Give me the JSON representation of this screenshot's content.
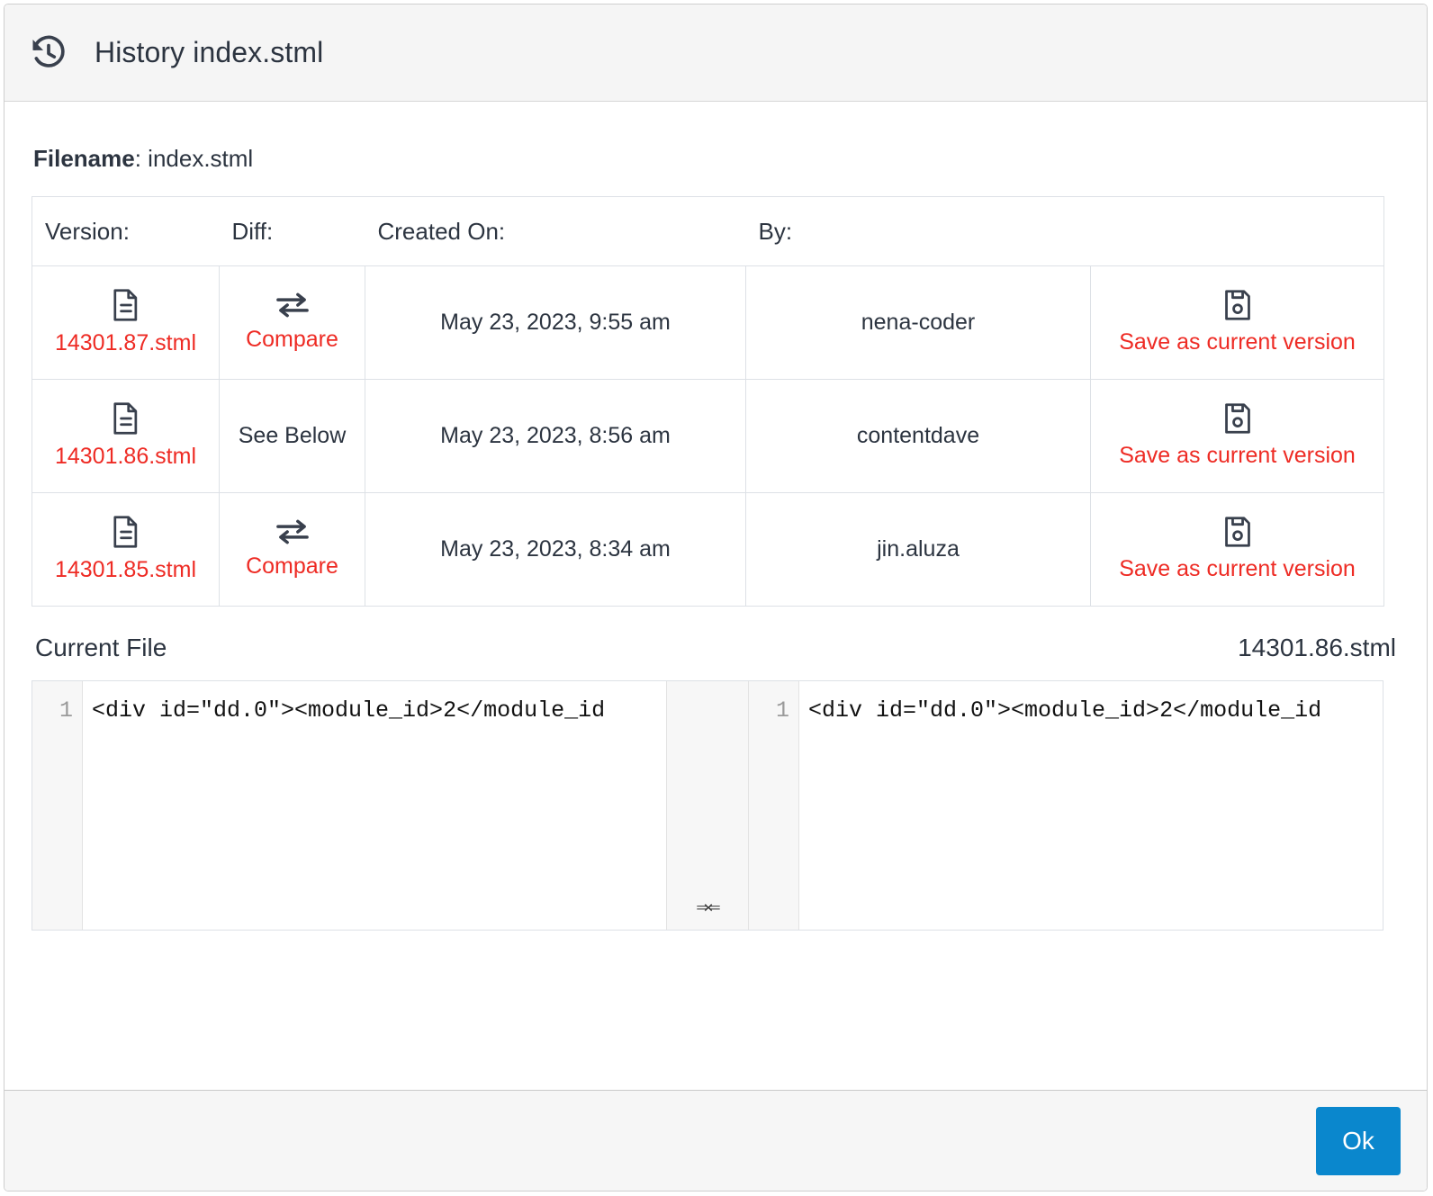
{
  "header": {
    "icon": "history-icon",
    "title": "History index.stml"
  },
  "body": {
    "filename_label": "Filename",
    "filename_sep": ": ",
    "filename_value": "index.stml"
  },
  "versions_table": {
    "columns": [
      "Version:",
      "Diff:",
      "Created On:",
      "By:",
      ""
    ],
    "rows": [
      {
        "file_icon": "file-document-icon",
        "version": "14301.87.stml",
        "diff_icon": "compare-arrows-icon",
        "diff_label": "Compare",
        "diff_is_link": true,
        "created_on": "May 23, 2023, 9:55 am",
        "by": "nena-coder",
        "save_icon": "floppy-save-icon",
        "save_label": "Save as current version"
      },
      {
        "file_icon": "file-document-icon",
        "version": "14301.86.stml",
        "diff_icon": "",
        "diff_label": "See Below",
        "diff_is_link": false,
        "created_on": "May 23, 2023, 8:56 am",
        "by": "contentdave",
        "save_icon": "floppy-save-icon",
        "save_label": "Save as current version"
      },
      {
        "file_icon": "file-document-icon",
        "version": "14301.85.stml",
        "diff_icon": "compare-arrows-icon",
        "diff_label": "Compare",
        "diff_is_link": true,
        "created_on": "May 23, 2023, 8:34 am",
        "by": "jin.aluza",
        "save_icon": "floppy-save-icon",
        "save_label": "Save as current version"
      }
    ]
  },
  "current_file": {
    "label": "Current File",
    "version": "14301.86.stml"
  },
  "diff_viewer": {
    "left": {
      "line_number": "1",
      "code": "<div id=\"dd.0\"><module_id>2</module_id"
    },
    "center": {
      "merge_arrows": "⇒⇐"
    },
    "right": {
      "line_number": "1",
      "code": "<div id=\"dd.0\"><module_id>2</module_id"
    }
  },
  "footer": {
    "ok_label": "Ok"
  },
  "colors": {
    "link_red": "#ee2b24",
    "primary_blue": "#0a87cd",
    "text_dark": "#2c3440",
    "border": "#dde1e6",
    "header_bg": "#f5f5f5"
  }
}
